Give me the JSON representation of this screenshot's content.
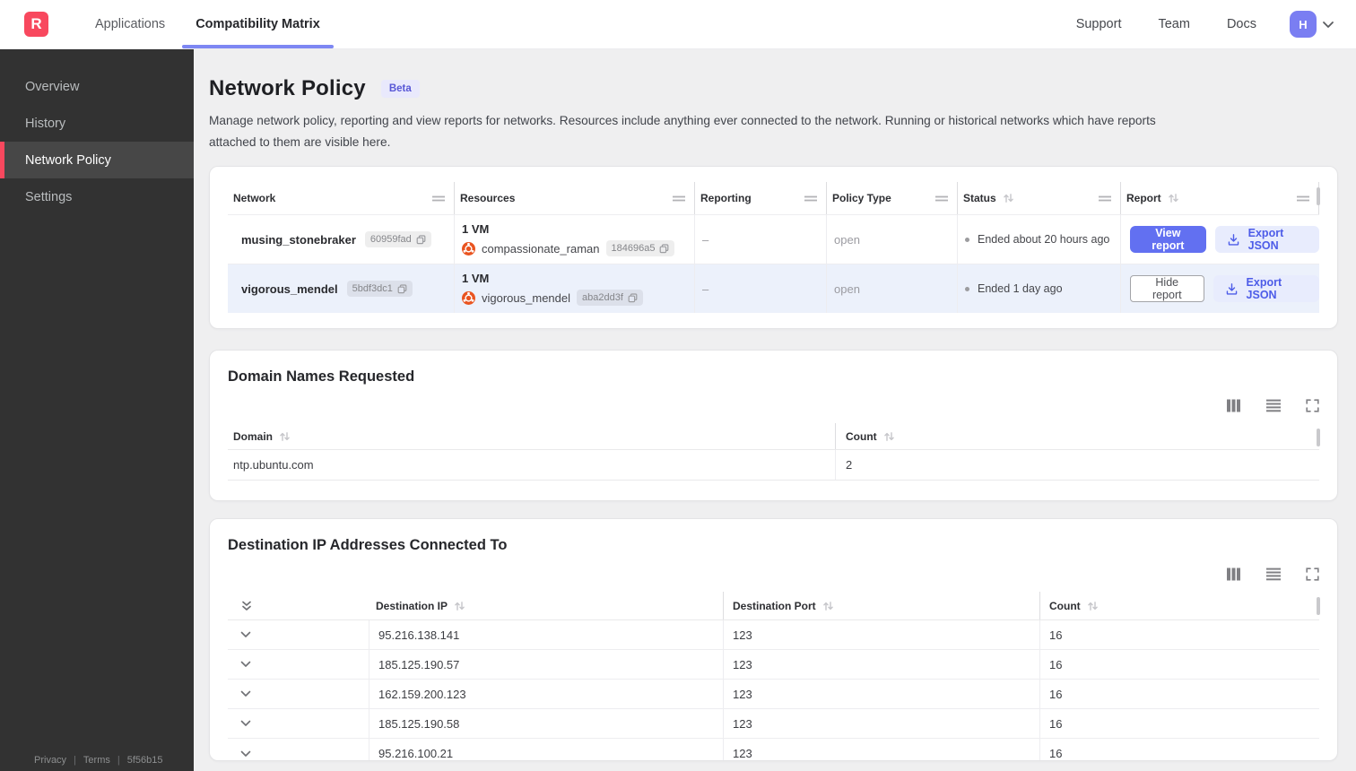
{
  "topnav": {
    "logo_letter": "R",
    "tabs": [
      {
        "label": "Applications",
        "active": false
      },
      {
        "label": "Compatibility Matrix",
        "active": true
      }
    ],
    "links": {
      "support": "Support",
      "team": "Team",
      "docs": "Docs"
    },
    "avatar_letter": "H"
  },
  "sidebar": {
    "items": [
      {
        "label": "Overview",
        "active": false
      },
      {
        "label": "History",
        "active": false
      },
      {
        "label": "Network Policy",
        "active": true
      },
      {
        "label": "Settings",
        "active": false
      }
    ],
    "footer": {
      "privacy": "Privacy",
      "terms": "Terms",
      "build": "5f56b15"
    }
  },
  "page": {
    "title": "Network Policy",
    "beta_badge": "Beta",
    "description": "Manage network policy, reporting and view reports for networks. Resources include anything ever connected to the network. Running or historical networks which have reports attached to them are visible here."
  },
  "network_table": {
    "columns": {
      "network": "Network",
      "resources": "Resources",
      "reporting": "Reporting",
      "policy_type": "Policy Type",
      "status": "Status",
      "report": "Report"
    },
    "rows": [
      {
        "name": "musing_stonebraker",
        "id": "60959fad",
        "vm_count": "1 VM",
        "vm_name": "compassionate_raman",
        "vm_id": "184696a5",
        "reporting": "–",
        "policy_type": "open",
        "status": "Ended about 20 hours ago",
        "report_button": "View report",
        "export_label": "Export JSON"
      },
      {
        "name": "vigorous_mendel",
        "id": "5bdf3dc1",
        "vm_count": "1 VM",
        "vm_name": "vigorous_mendel",
        "vm_id": "aba2dd3f",
        "reporting": "–",
        "policy_type": "open",
        "status": "Ended 1 day ago",
        "report_button": "Hide report",
        "export_label": "Export JSON"
      }
    ]
  },
  "domain_card": {
    "title": "Domain Names Requested",
    "columns": {
      "domain": "Domain",
      "count": "Count"
    },
    "rows": [
      {
        "domain": "ntp.ubuntu.com",
        "count": "2"
      }
    ]
  },
  "destination_card": {
    "title": "Destination IP Addresses Connected To",
    "columns": {
      "ip": "Destination IP",
      "port": "Destination Port",
      "count": "Count"
    },
    "rows": [
      {
        "ip": "95.216.138.141",
        "port": "123",
        "count": "16"
      },
      {
        "ip": "185.125.190.57",
        "port": "123",
        "count": "16"
      },
      {
        "ip": "162.159.200.123",
        "port": "123",
        "count": "16"
      },
      {
        "ip": "185.125.190.58",
        "port": "123",
        "count": "16"
      },
      {
        "ip": "95.216.100.21",
        "port": "123",
        "count": "16"
      }
    ]
  },
  "colors": {
    "brand_red": "#f8485e",
    "accent_indigo": "#6270f1",
    "tab_underline": "#7d87f3",
    "avatar_bg": "#7a7ef2",
    "beta_bg": "#e9e9fc",
    "beta_text": "#5857d6",
    "export_chip_bg": "#e8ecfd",
    "export_chip_text": "#4d5ce8",
    "sidebar_bg": "#323232",
    "sidebar_active_bg": "#474747",
    "selected_row_bg": "#ecf1fb",
    "page_bg": "#efeff0",
    "ubuntu_orange": "#e95420"
  }
}
